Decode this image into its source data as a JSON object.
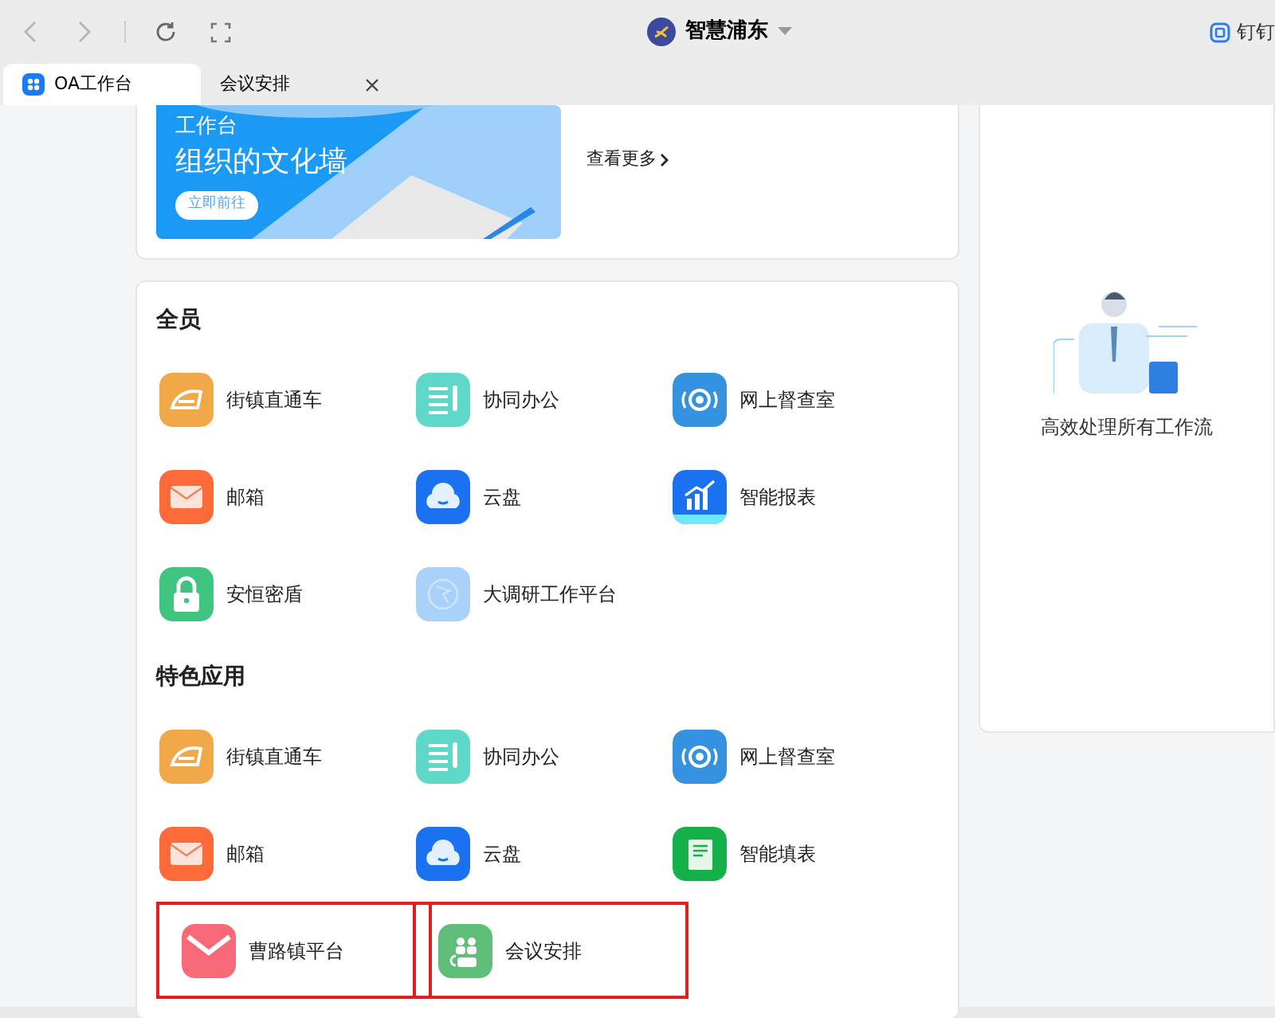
{
  "toolbar": {
    "app_title": "智慧浦东",
    "right_link": "钉钉"
  },
  "tabs": [
    {
      "label": "OA工作台",
      "selected": true,
      "closable": false
    },
    {
      "label": "会议安排",
      "selected": false,
      "closable": true
    }
  ],
  "banner": {
    "subtitle": "工作台",
    "title": "组织的文化墙",
    "button": "立即前往",
    "more_link": "查看更多"
  },
  "sections": [
    {
      "title": "全员",
      "apps": [
        {
          "label": "街镇直通车",
          "kind": "train",
          "color": "#f0a848",
          "highlighted": false
        },
        {
          "label": "协同办公",
          "kind": "notes",
          "color": "#5fd8c8",
          "highlighted": false
        },
        {
          "label": "网上督查室",
          "kind": "radar",
          "color": "#3592e0",
          "highlighted": false
        },
        {
          "label": "邮箱",
          "kind": "mail",
          "color": "#fb6a38",
          "highlighted": false
        },
        {
          "label": "云盘",
          "kind": "cloud",
          "color": "#1a72f0",
          "highlighted": false
        },
        {
          "label": "智能报表",
          "kind": "chart",
          "color": "#1a72f0",
          "highlighted": false
        },
        {
          "label": "安恒密盾",
          "kind": "lock",
          "color": "#3fc57f",
          "highlighted": false
        },
        {
          "label": "大调研工作平台",
          "kind": "survey",
          "color": "#a9d2fb",
          "highlighted": false
        }
      ]
    },
    {
      "title": "特色应用",
      "apps": [
        {
          "label": "街镇直通车",
          "kind": "train",
          "color": "#f0a848",
          "highlighted": false
        },
        {
          "label": "协同办公",
          "kind": "notes",
          "color": "#5fd8c8",
          "highlighted": false
        },
        {
          "label": "网上督查室",
          "kind": "radar",
          "color": "#3592e0",
          "highlighted": false
        },
        {
          "label": "邮箱",
          "kind": "mail",
          "color": "#fb6a38",
          "highlighted": false
        },
        {
          "label": "云盘",
          "kind": "cloud",
          "color": "#1a72f0",
          "highlighted": false
        },
        {
          "label": "智能填表",
          "kind": "form",
          "color": "#16b04a",
          "highlighted": false
        },
        {
          "label": "曹路镇平台",
          "kind": "envelope",
          "color": "#f86a78",
          "highlighted": true
        },
        {
          "label": "会议安排",
          "kind": "people",
          "color": "#5fbf7a",
          "highlighted": true
        }
      ]
    }
  ],
  "todo_panel": {
    "caption": "高效处理所有工作流"
  }
}
